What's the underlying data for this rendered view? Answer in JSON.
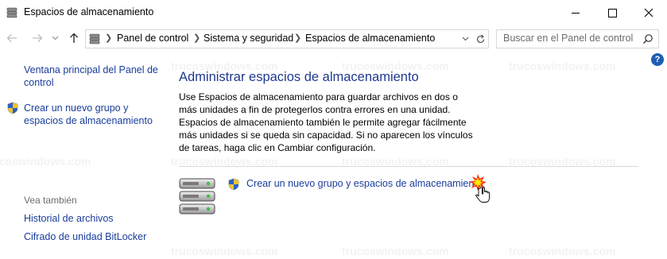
{
  "window": {
    "title": "Espacios de almacenamiento"
  },
  "address_bar": {
    "crumbs": [
      "Panel de control",
      "Sistema y seguridad",
      "Espacios de almacenamiento"
    ],
    "search_placeholder": "Buscar en el Panel de control"
  },
  "left_pane": {
    "home_link": "Ventana principal del Panel de control",
    "create_link": "Crear un nuevo grupo y espacios de almacenamiento",
    "see_also_label": "Vea también",
    "see_also_links": [
      "Historial de archivos",
      "Cifrado de unidad BitLocker"
    ]
  },
  "main": {
    "title": "Administrar espacios de almacenamiento",
    "description": "Use Espacios de almacenamiento para guardar archivos en dos o más unidades a fin de protegerlos contra errores en una unidad. Espacios de almacenamiento también le permite agregar fácilmente más unidades si se queda sin capacidad. Si no aparecen los vínculos de tareas, haga clic en Cambiar configuración.",
    "task_link": "Crear un nuevo grupo y espacios de almacenamiento"
  },
  "help_label": "?",
  "watermark": "trucoswindows.com",
  "colors": {
    "link": "#1a3d9c",
    "title_blue": "#1e3a8f",
    "help_blue": "#1f5fb4"
  },
  "icons": [
    "storage-spaces-icon",
    "back-arrow-icon",
    "forward-arrow-icon",
    "recent-dropdown-icon",
    "up-arrow-icon",
    "refresh-icon",
    "search-icon",
    "help-icon",
    "uac-shield-icon",
    "drives-stack-icon",
    "pointer-hand-icon"
  ]
}
